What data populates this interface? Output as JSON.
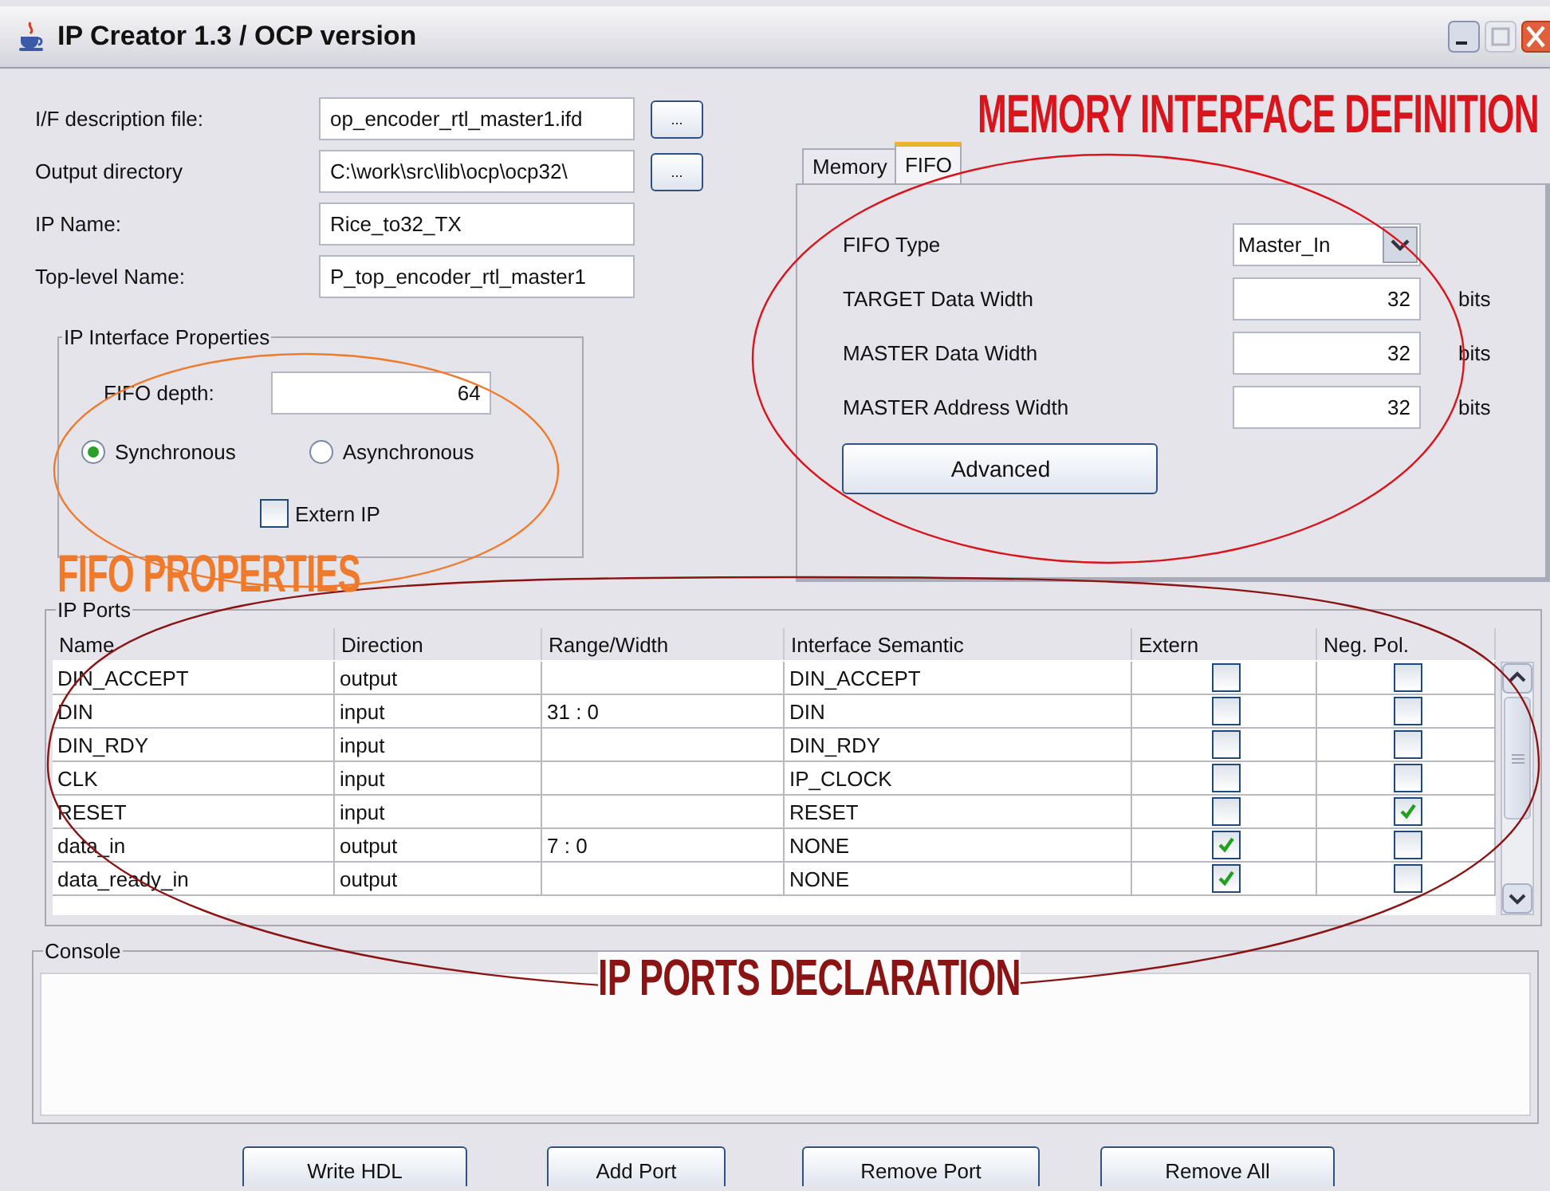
{
  "window": {
    "title": "IP Creator 1.3 / OCP version"
  },
  "form": [
    {
      "label": "I/F description file:",
      "value": "op_encoder_rtl_master1.ifd",
      "browse": "..."
    },
    {
      "label": "Output directory",
      "value": "C:\\work\\src\\lib\\ocp\\ocp32\\",
      "browse": "..."
    },
    {
      "label": "IP Name:",
      "value": "Rice_to32_TX"
    },
    {
      "label": "Top-level Name:",
      "value": "P_top_encoder_rtl_master1"
    }
  ],
  "interface_properties": {
    "title": "IP Interface Properties",
    "fifo_depth": {
      "label": "FIFO depth:",
      "value": "64"
    },
    "modes": [
      {
        "label": "Synchronous",
        "selected": true
      },
      {
        "label": "Asynchronous",
        "selected": false
      }
    ],
    "extern_ip": {
      "label": "Extern IP",
      "checked": false
    }
  },
  "tabs": [
    {
      "label": "Memory",
      "selected": false
    },
    {
      "label": "FIFO",
      "selected": true
    }
  ],
  "fifo": {
    "type": {
      "label": "FIFO Type",
      "value": "Master_In"
    },
    "widths": [
      {
        "label": "TARGET Data Width",
        "value": "32",
        "unit": "bits"
      },
      {
        "label": "MASTER Data Width",
        "value": "32",
        "unit": "bits"
      },
      {
        "label": "MASTER Address Width",
        "value": "32",
        "unit": "bits"
      }
    ],
    "advanced_button": "Advanced"
  },
  "ports": {
    "title": "IP Ports",
    "columns": [
      "Name",
      "Direction",
      "Range/Width",
      "Interface Semantic",
      "Extern",
      "Neg. Pol."
    ],
    "rows": [
      {
        "name": "DIN_ACCEPT",
        "direction": "output",
        "range": "",
        "semantic": "DIN_ACCEPT",
        "extern": false,
        "neg_pol": false
      },
      {
        "name": "DIN",
        "direction": "input",
        "range": "31 : 0",
        "semantic": "DIN",
        "extern": false,
        "neg_pol": false
      },
      {
        "name": "DIN_RDY",
        "direction": "input",
        "range": "",
        "semantic": "DIN_RDY",
        "extern": false,
        "neg_pol": false
      },
      {
        "name": "CLK",
        "direction": "input",
        "range": "",
        "semantic": "IP_CLOCK",
        "extern": false,
        "neg_pol": false
      },
      {
        "name": "RESET",
        "direction": "input",
        "range": "",
        "semantic": "RESET",
        "extern": false,
        "neg_pol": true
      },
      {
        "name": "data_in",
        "direction": "output",
        "range": "7 : 0",
        "semantic": "NONE",
        "extern": true,
        "neg_pol": false
      },
      {
        "name": "data_ready_in",
        "direction": "output",
        "range": "",
        "semantic": "NONE",
        "extern": true,
        "neg_pol": false
      }
    ]
  },
  "console": {
    "title": "Console"
  },
  "buttons": [
    "Write HDL",
    "Add Port",
    "Remove Port",
    "Remove All"
  ],
  "annotations": [
    {
      "text": "MEMORY INTERFACE DEFINITION",
      "color": "#d8141c"
    },
    {
      "text": "FIFO PROPERTIES",
      "color": "#f07a2c"
    },
    {
      "text": "IP PORTS DECLARATION",
      "color": "#8a1414"
    }
  ]
}
